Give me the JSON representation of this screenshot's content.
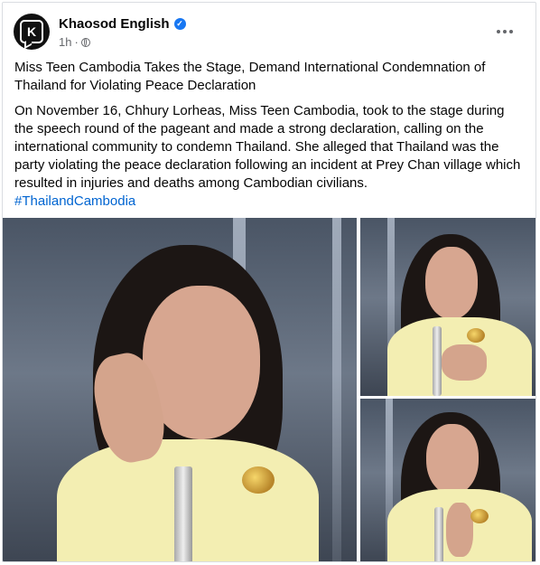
{
  "post": {
    "page_name": "Khaosod English",
    "avatar_letter": "K",
    "time": "1h",
    "dot": "·",
    "headline": "Miss Teen Cambodia Takes the Stage, Demand International Condemnation of Thailand for Violating Peace Declaration",
    "body": "On November 16, Chhury Lorheas, Miss Teen Cambodia, took to the stage during the speech round of the pageant and made a strong declaration, calling on the international community to condemn Thailand. She alleged that Thailand was the party violating the peace declaration following an incident at Prey Chan village which resulted in injuries and deaths among Cambodian civilians.",
    "hashtag": "#ThailandCambodia"
  },
  "icons": {
    "verified": "verified-badge-icon",
    "privacy": "globe-icon",
    "more": "more-options-icon"
  },
  "colors": {
    "link": "#0064d1",
    "verified": "#1877f2",
    "muted": "#65676b"
  }
}
